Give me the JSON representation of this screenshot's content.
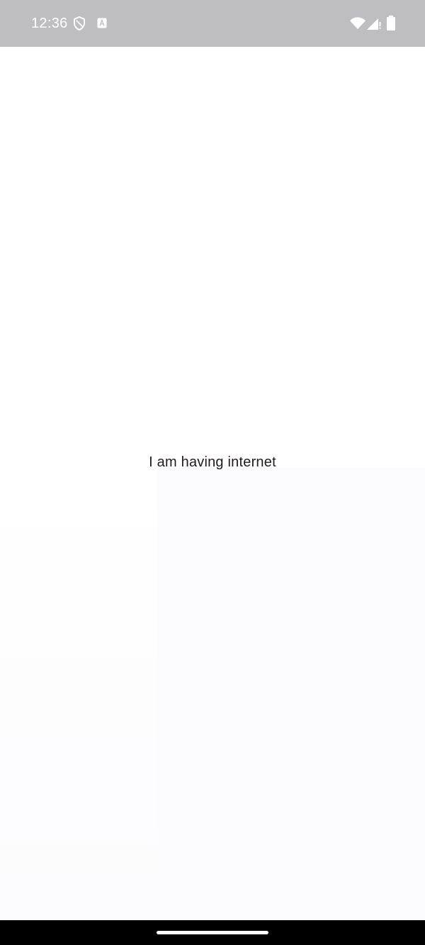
{
  "status_bar": {
    "time": "12:36",
    "background_color": "#bebdbf",
    "icons": [
      "shield-icon",
      "a-notification-icon",
      "wifi-icon",
      "signal-icon",
      "battery-icon"
    ]
  },
  "main": {
    "message": "I am having internet",
    "background_color": "#ffffff",
    "text_color": "#1f1b1f"
  },
  "nav_bar": {
    "background_color": "#000000",
    "handle": "home-gesture-handle"
  }
}
